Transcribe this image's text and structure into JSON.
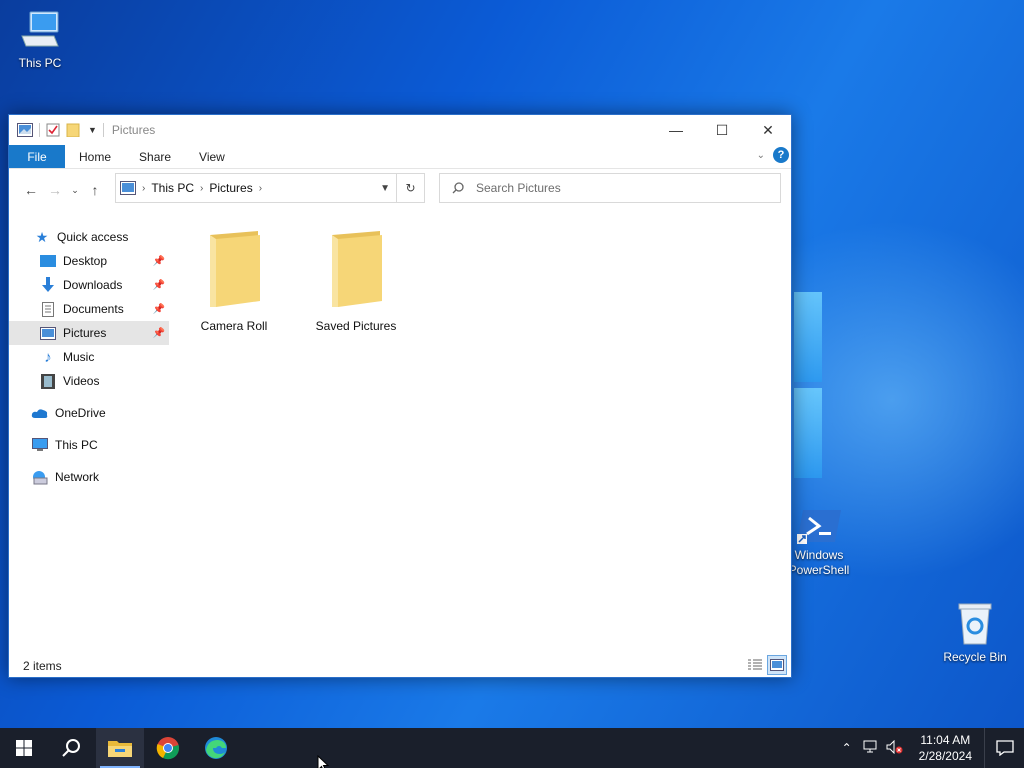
{
  "desktop": {
    "icons": [
      {
        "label": "This PC"
      },
      {
        "label_line1": "Windows",
        "label_line2": "PowerShell"
      },
      {
        "label": "Recycle Bin"
      }
    ]
  },
  "window": {
    "title": "Pictures",
    "ribbon": {
      "file": "File",
      "home": "Home",
      "share": "Share",
      "view": "View",
      "help": "?"
    },
    "address": {
      "crumbs": [
        "This PC",
        "Pictures"
      ]
    },
    "search": {
      "placeholder": "Search Pictures"
    },
    "nav": {
      "quick_access": "Quick access",
      "items": [
        "Desktop",
        "Downloads",
        "Documents",
        "Pictures",
        "Music",
        "Videos"
      ],
      "onedrive": "OneDrive",
      "this_pc": "This PC",
      "network": "Network"
    },
    "folders": [
      {
        "name": "Camera Roll"
      },
      {
        "name": "Saved Pictures"
      }
    ],
    "status": "2 items"
  },
  "taskbar": {
    "time": "11:04 AM",
    "date": "2/28/2024"
  },
  "colors": {
    "accent": "#1979ca",
    "folder": "#f6d677",
    "taskbar": "#1a1f2b"
  }
}
